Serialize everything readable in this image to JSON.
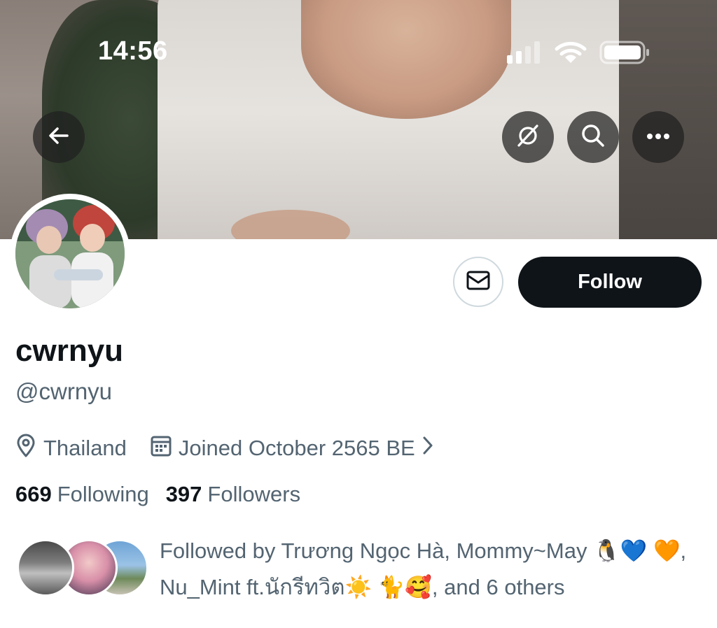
{
  "status_bar": {
    "time": "14:56"
  },
  "profile": {
    "display_name": "cwrnyu",
    "handle": "@cwrnyu",
    "location": "Thailand",
    "joined": "Joined October 2565 BE",
    "following_count": "669",
    "following_label": "Following",
    "followers_count": "397",
    "followers_label": "Followers"
  },
  "actions": {
    "follow_label": "Follow"
  },
  "followed_by": {
    "prefix": "Followed by Trương Ngọc Hà, Mommy~May",
    "emoji1": "🐧",
    "emoji2": "💙",
    "emoji3": "🧡",
    "middle": ", Nu_Mint ft.นักรีทวิต",
    "emoji4": "☀️",
    "emoji5": "🐈",
    "emoji6": "🥰",
    "suffix": ", and 6 others"
  },
  "icons": {
    "back": "back-arrow-icon",
    "grok": "grok-icon",
    "search": "search-icon",
    "more": "more-icon",
    "message": "envelope-icon",
    "location": "location-pin-icon",
    "calendar": "calendar-icon",
    "chevron": "chevron-right-icon"
  },
  "colors": {
    "primary_text": "#0f1419",
    "secondary_text": "#536471",
    "follow_button_bg": "#0f1419",
    "border": "#cfd9de"
  }
}
